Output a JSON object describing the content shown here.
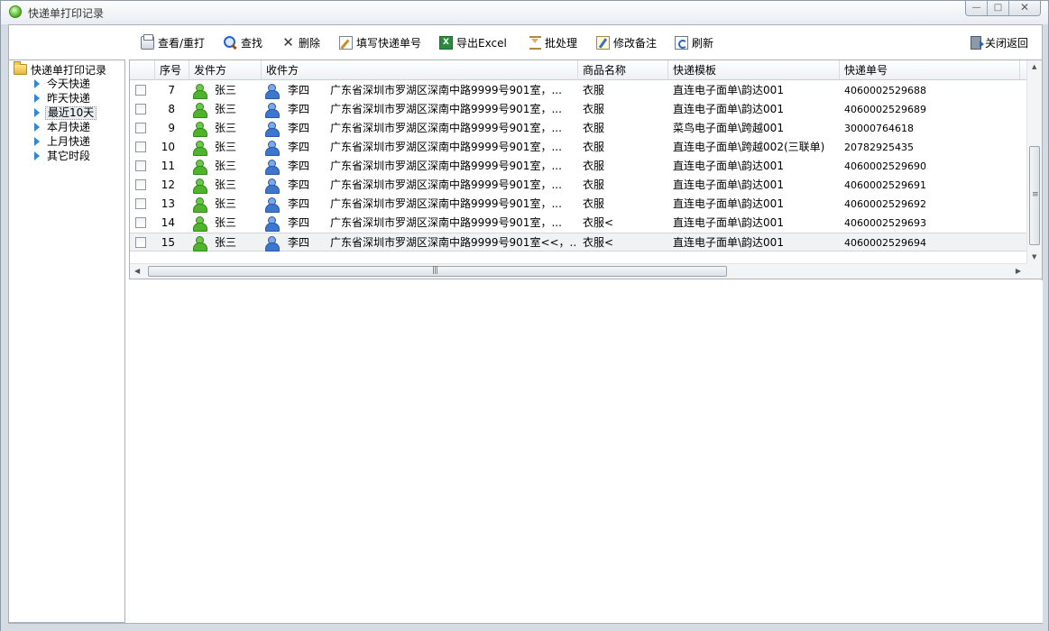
{
  "window": {
    "title": "快递单打印记录"
  },
  "toolbar": {
    "view_reprint": "查看/重打",
    "search": "查找",
    "delete": "删除",
    "fill_tracking": "填写快递单号",
    "export_excel": "导出Excel",
    "batch": "批处理",
    "edit_note": "修改备注",
    "refresh": "刷新",
    "close_return": "关闭返回"
  },
  "tree": {
    "root": "快递单打印记录",
    "items": [
      "今天快递",
      "昨天快递",
      "最近10天",
      "本月快递",
      "上月快递",
      "其它时段"
    ],
    "selected_index": 2
  },
  "grid": {
    "columns": [
      "序号",
      "发件方",
      "收件方",
      "商品名称",
      "快递模板",
      "快递单号"
    ],
    "rows": [
      {
        "no": "7",
        "sender": "张三",
        "receiver": "李四",
        "address": "广东省深圳市罗湖区深南中路9999号901室，...",
        "goods": "衣服",
        "template": "直连电子面单\\韵达001",
        "tracking": "4060002529688"
      },
      {
        "no": "8",
        "sender": "张三",
        "receiver": "李四",
        "address": "广东省深圳市罗湖区深南中路9999号901室，...",
        "goods": "衣服",
        "template": "直连电子面单\\韵达001",
        "tracking": "4060002529689"
      },
      {
        "no": "9",
        "sender": "张三",
        "receiver": "李四",
        "address": "广东省深圳市罗湖区深南中路9999号901室，...",
        "goods": "衣服",
        "template": "菜鸟电子面单\\跨越001",
        "tracking": "30000764618"
      },
      {
        "no": "10",
        "sender": "张三",
        "receiver": "李四",
        "address": "广东省深圳市罗湖区深南中路9999号901室，...",
        "goods": "衣服",
        "template": "直连电子面单\\跨越002(三联单)",
        "tracking": "20782925435"
      },
      {
        "no": "11",
        "sender": "张三",
        "receiver": "李四",
        "address": "广东省深圳市罗湖区深南中路9999号901室，...",
        "goods": "衣服",
        "template": "直连电子面单\\韵达001",
        "tracking": "4060002529690"
      },
      {
        "no": "12",
        "sender": "张三",
        "receiver": "李四",
        "address": "广东省深圳市罗湖区深南中路9999号901室，...",
        "goods": "衣服",
        "template": "直连电子面单\\韵达001",
        "tracking": "4060002529691"
      },
      {
        "no": "13",
        "sender": "张三",
        "receiver": "李四",
        "address": "广东省深圳市罗湖区深南中路9999号901室，...",
        "goods": "衣服",
        "template": "直连电子面单\\韵达001",
        "tracking": "4060002529692"
      },
      {
        "no": "14",
        "sender": "张三",
        "receiver": "李四",
        "address": "广东省深圳市罗湖区深南中路9999号901室，...",
        "goods": "衣服<",
        "template": "直连电子面单\\韵达001",
        "tracking": "4060002529693"
      },
      {
        "no": "15",
        "sender": "张三",
        "receiver": "李四",
        "address": "广东省深圳市罗湖区深南中路9999号901室<<，...",
        "goods": "衣服<",
        "template": "直连电子面单\\韵达001",
        "tracking": "4060002529694"
      }
    ],
    "selected_row": 8
  }
}
